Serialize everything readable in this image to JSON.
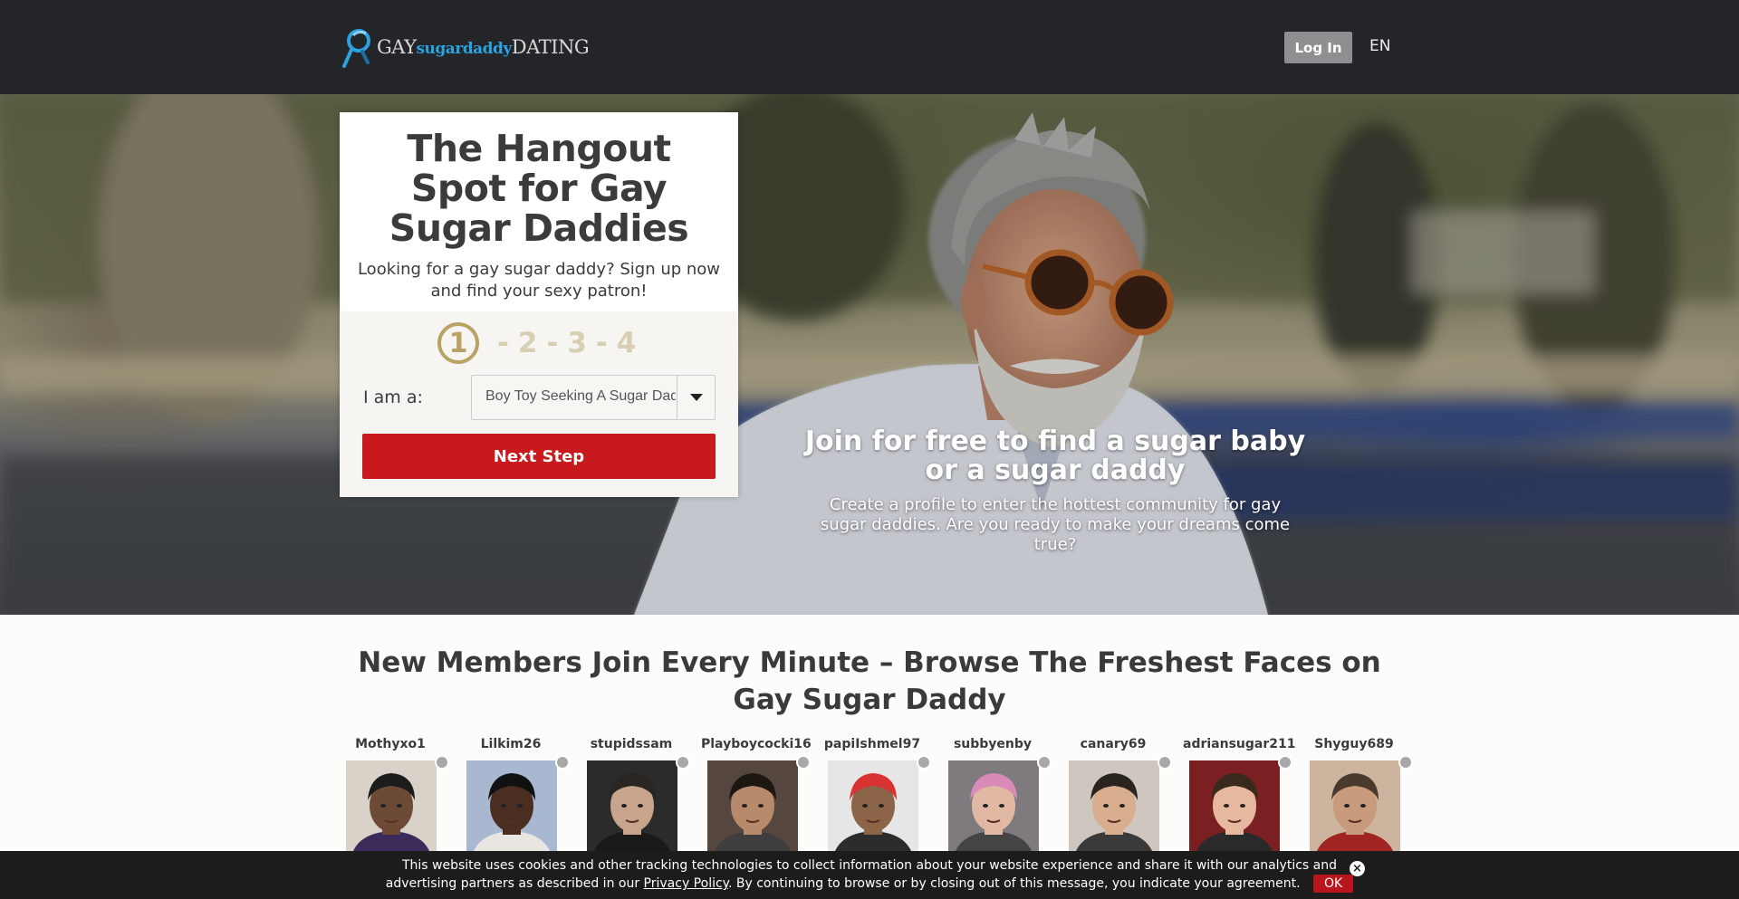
{
  "header": {
    "logo": {
      "part1": "GAY",
      "part2": "sugardaddy",
      "part3": "DATING"
    },
    "login_label": "Log In",
    "language": "EN"
  },
  "signup_card": {
    "title": "The Hangout Spot for Gay Sugar Daddies",
    "subtitle": "Looking for a gay sugar daddy? Sign up now and find your sexy patron!",
    "steps": [
      "1",
      "2",
      "3",
      "4"
    ],
    "active_step": 1,
    "iam_label": "I am a:",
    "iam_value": "Boy Toy Seeking A Sugar Daddy",
    "next_label": "Next Step"
  },
  "hero": {
    "title": "Join for free to find a sugar baby or a sugar daddy",
    "subtitle": "Create a profile to enter the hottest community for gay sugar daddies. Are you ready to make your dreams come true?"
  },
  "members": {
    "title": "New Members Join Every Minute – Browse The Freshest Faces on Gay Sugar Daddy",
    "list": [
      {
        "name": "Mothyxo1",
        "skin": "#6d4a36",
        "hair": "#1c1c1c",
        "bg": "#d9d2c8",
        "shirt": "#3b2a5a"
      },
      {
        "name": "Lilkim26",
        "skin": "#4a2e22",
        "hair": "#111111",
        "bg": "#a7b8d0",
        "shirt": "#e9e6e2"
      },
      {
        "name": "stupidssam",
        "skin": "#c9a48c",
        "hair": "#2a2520",
        "bg": "#2b2b2b",
        "shirt": "#1a1a1a"
      },
      {
        "name": "Playboycocki16",
        "skin": "#b88a6c",
        "hair": "#1d1712",
        "bg": "#55463f",
        "shirt": "#3e3e3e"
      },
      {
        "name": "papiIshmel97",
        "skin": "#8c6448",
        "hair": "#d93232",
        "bg": "#e6e6e6",
        "shirt": "#2c2c2c"
      },
      {
        "name": "subbyenby",
        "skin": "#e1b8a4",
        "hair": "#d98ab8",
        "bg": "#7e7a7e",
        "shirt": "#444444"
      },
      {
        "name": "canary69",
        "skin": "#d8ae8f",
        "hair": "#2a241f",
        "bg": "#cfc7bf",
        "shirt": "#3a3a3a"
      },
      {
        "name": "adriansugar211",
        "skin": "#e7b8a0",
        "hair": "#3a2a1e",
        "bg": "#7a1f22",
        "shirt": "#2a2a2a"
      },
      {
        "name": "Shyguy689",
        "skin": "#c89b7d",
        "hair": "#4a3a2e",
        "bg": "#cdb49e",
        "shirt": "#a0241f"
      }
    ]
  },
  "cookie": {
    "text_before": "This website uses cookies and other tracking technologies to collect information about your website experience and share it with our analytics and advertising partners as described in our ",
    "privacy_label": "Privacy Policy",
    "text_after": ". By continuing to browse or by closing out of this message, you indicate your agreement.",
    "ok_label": "OK",
    "close_icon": "close-icon"
  },
  "colors": {
    "header_bg": "#232528",
    "accent_red": "#c8191d",
    "step_gold": "#b8a365",
    "logo_blue": "#2ba3e0"
  }
}
